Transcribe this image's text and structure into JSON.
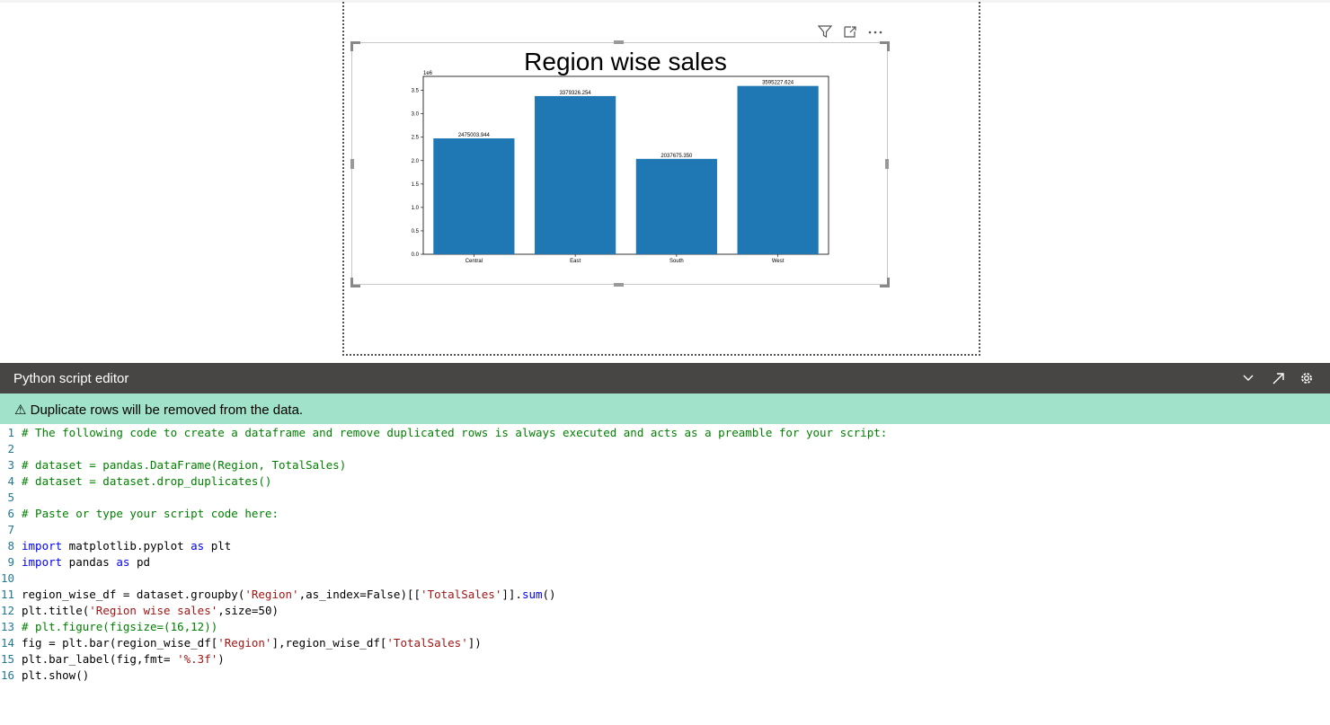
{
  "visual": {
    "icons": {
      "filter": "filter-icon",
      "focus": "focus-mode-icon",
      "more": "more-options-icon"
    }
  },
  "chart_data": {
    "type": "bar",
    "title": "Region wise sales",
    "categories": [
      "Central",
      "East",
      "South",
      "West"
    ],
    "values": [
      2475003.944,
      3379326.254,
      2037675.35,
      3595227.624
    ],
    "value_labels": [
      "2475003.944",
      "3379326.254",
      "2037675.350",
      "3595227.624"
    ],
    "ylim": [
      0,
      3800000
    ],
    "y_ticks": [
      0,
      500000,
      1000000,
      1500000,
      2000000,
      2500000,
      3000000,
      3500000
    ],
    "y_tick_labels": [
      "0.0",
      "0.5",
      "1.0",
      "1.5",
      "2.0",
      "2.5",
      "3.0",
      "3.5"
    ],
    "y_scale_label": "1e6",
    "bar_color": "#1f77b4",
    "xlabel": "",
    "ylabel": ""
  },
  "editor": {
    "title": "Python script editor",
    "icons": {
      "collapse": "chevron-down-icon",
      "expand": "expand-icon",
      "settings": "gear-icon"
    }
  },
  "warning": {
    "icon": "⚠",
    "text": "Duplicate rows will be removed from the data."
  },
  "code_lines": [
    [
      {
        "t": "# The following code to create a dataframe and remove duplicated rows is always executed and acts as a preamble for your script:",
        "c": "cm"
      }
    ],
    [],
    [
      {
        "t": "# dataset = pandas.DataFrame(Region, TotalSales)",
        "c": "cm"
      }
    ],
    [
      {
        "t": "# dataset = dataset.drop_duplicates()",
        "c": "cm"
      }
    ],
    [],
    [
      {
        "t": "# Paste or type your script code here:",
        "c": "cm"
      }
    ],
    [],
    [
      {
        "t": "import",
        "c": "kw"
      },
      {
        "t": " matplotlib.pyplot ",
        "c": "df"
      },
      {
        "t": "as",
        "c": "kw"
      },
      {
        "t": " plt",
        "c": "df"
      }
    ],
    [
      {
        "t": "import",
        "c": "kw"
      },
      {
        "t": " pandas ",
        "c": "df"
      },
      {
        "t": "as",
        "c": "kw"
      },
      {
        "t": " pd",
        "c": "df"
      }
    ],
    [],
    [
      {
        "t": "region_wise_df = dataset.groupby(",
        "c": "df"
      },
      {
        "t": "'Region'",
        "c": "st"
      },
      {
        "t": ",as_index=False)[[",
        "c": "df"
      },
      {
        "t": "'TotalSales'",
        "c": "st"
      },
      {
        "t": "]].",
        "c": "df"
      },
      {
        "t": "sum",
        "c": "kw"
      },
      {
        "t": "()",
        "c": "df"
      }
    ],
    [
      {
        "t": "plt.title(",
        "c": "df"
      },
      {
        "t": "'Region wise sales'",
        "c": "st"
      },
      {
        "t": ",size=50)",
        "c": "df"
      }
    ],
    [
      {
        "t": "# plt.figure(figsize=(16,12))",
        "c": "cm"
      }
    ],
    [
      {
        "t": "fig = plt.bar(region_wise_df[",
        "c": "df"
      },
      {
        "t": "'Region'",
        "c": "st"
      },
      {
        "t": "],region_wise_df[",
        "c": "df"
      },
      {
        "t": "'TotalSales'",
        "c": "st"
      },
      {
        "t": "])",
        "c": "df"
      }
    ],
    [
      {
        "t": "plt.bar_label(fig,fmt= ",
        "c": "df"
      },
      {
        "t": "'%.3f'",
        "c": "st"
      },
      {
        "t": ")",
        "c": "df"
      }
    ],
    [
      {
        "t": "plt.show()",
        "c": "df"
      }
    ]
  ]
}
